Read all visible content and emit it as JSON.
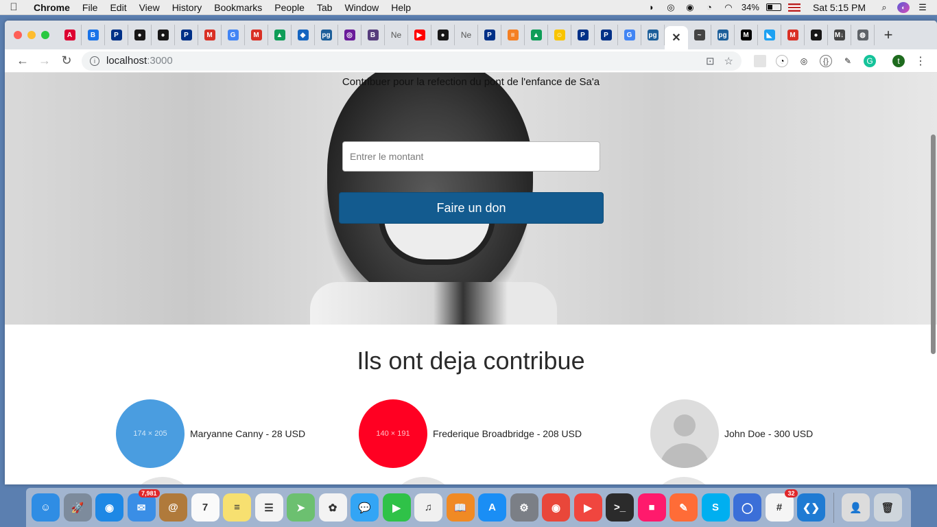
{
  "menubar": {
    "app_name": "Chrome",
    "items": [
      "File",
      "Edit",
      "View",
      "History",
      "Bookmarks",
      "People",
      "Tab",
      "Window",
      "Help"
    ],
    "battery": "34%",
    "clock": "Sat 5:15 PM"
  },
  "tabs": [
    {
      "icon": "angular-icon",
      "color": "#dd0031",
      "glyph": "A"
    },
    {
      "icon": "bootstrap-icon",
      "color": "#1a73e8",
      "glyph": "B"
    },
    {
      "icon": "paypal-icon",
      "color": "#003087",
      "glyph": "P"
    },
    {
      "icon": "github-icon",
      "color": "#181717",
      "glyph": "●"
    },
    {
      "icon": "github-icon",
      "color": "#181717",
      "glyph": "●"
    },
    {
      "icon": "paypal-icon",
      "color": "#003087",
      "glyph": "P"
    },
    {
      "icon": "gmail-icon",
      "color": "#d93025",
      "glyph": "M"
    },
    {
      "icon": "google-icon",
      "color": "#4285f4",
      "glyph": "G"
    },
    {
      "icon": "gmail-icon",
      "color": "#d93025",
      "glyph": "M"
    },
    {
      "icon": "drive-icon",
      "color": "#0f9d58",
      "glyph": "▲"
    },
    {
      "icon": "cube-icon",
      "color": "#1565c0",
      "glyph": "◆"
    },
    {
      "icon": "pg-icon",
      "color": "#1d5f9a",
      "glyph": "pg"
    },
    {
      "icon": "circle-icon",
      "color": "#6a1b9a",
      "glyph": "◎"
    },
    {
      "icon": "bootstrap-icon",
      "color": "#563d7c",
      "glyph": "B"
    },
    {
      "icon": "text-tab",
      "color": "#666666",
      "glyph": "Ne"
    },
    {
      "icon": "youtube-icon",
      "color": "#ff0000",
      "glyph": "▶"
    },
    {
      "icon": "github-icon",
      "color": "#181717",
      "glyph": "●"
    },
    {
      "icon": "text-tab",
      "color": "#666666",
      "glyph": "Ne"
    },
    {
      "icon": "paypal-icon",
      "color": "#003087",
      "glyph": "P"
    },
    {
      "icon": "stackoverflow-icon",
      "color": "#f48024",
      "glyph": "≡"
    },
    {
      "icon": "drive-icon",
      "color": "#0f9d58",
      "glyph": "▲"
    },
    {
      "icon": "emoji-icon",
      "color": "#f9c400",
      "glyph": "☺"
    },
    {
      "icon": "paypal-icon",
      "color": "#003087",
      "glyph": "P"
    },
    {
      "icon": "paypal-icon",
      "color": "#003087",
      "glyph": "P"
    },
    {
      "icon": "google-icon",
      "color": "#4285f4",
      "glyph": "G"
    },
    {
      "icon": "pg-icon",
      "color": "#1d5f9a",
      "glyph": "pg"
    }
  ],
  "tabs_after": [
    {
      "icon": "wave-icon",
      "color": "#444444",
      "glyph": "~"
    },
    {
      "icon": "pg-icon",
      "color": "#1d5f9a",
      "glyph": "pg"
    },
    {
      "icon": "medium-icon",
      "color": "#000000",
      "glyph": "M"
    },
    {
      "icon": "bird-icon",
      "color": "#1da1f2",
      "glyph": "◣"
    },
    {
      "icon": "gmail-icon",
      "color": "#d93025",
      "glyph": "M"
    },
    {
      "icon": "github-icon",
      "color": "#181717",
      "glyph": "●"
    },
    {
      "icon": "markdown-icon",
      "color": "#444444",
      "glyph": "M↓"
    },
    {
      "icon": "globe-icon",
      "color": "#5f6368",
      "glyph": "◍"
    }
  ],
  "active_tab_close": "✕",
  "new_tab": "+",
  "address": {
    "host": "localhost",
    "port": ":3000"
  },
  "hero": {
    "title": "Contribuer pour la refection du pont de l'enfance de Sa'a",
    "amount_placeholder": "Entrer le montant",
    "donate_label": "Faire un don"
  },
  "contributors": {
    "heading": "Ils ont deja contribue",
    "items": [
      {
        "label": "Maryanne Canny - 28 USD",
        "avatar_text": "174 × 205",
        "avatar_color": "#4a9de0"
      },
      {
        "label": "Frederique Broadbridge - 208 USD",
        "avatar_text": "140 × 191",
        "avatar_color": "#ff0022"
      },
      {
        "label": "John Doe - 300 USD",
        "avatar_text": "",
        "avatar_color": "#dddddd"
      }
    ]
  },
  "dock": {
    "apps": [
      {
        "name": "finder-icon",
        "color": "#2f8de4",
        "glyph": "☺"
      },
      {
        "name": "launchpad-icon",
        "color": "#7d8b9c",
        "glyph": "🚀"
      },
      {
        "name": "safari-icon",
        "color": "#1e88e5",
        "glyph": "◉"
      },
      {
        "name": "mail-icon",
        "color": "#3a8ee6",
        "glyph": "✉",
        "badge": "7,981"
      },
      {
        "name": "contacts-icon",
        "color": "#b07a3b",
        "glyph": "@"
      },
      {
        "name": "calendar-icon",
        "color": "#fafafa",
        "glyph": "7",
        "dark": true
      },
      {
        "name": "notes-icon",
        "color": "#f7e070",
        "glyph": "≡",
        "dark": true
      },
      {
        "name": "reminders-icon",
        "color": "#f4f4f4",
        "glyph": "☰",
        "dark": true
      },
      {
        "name": "maps-icon",
        "color": "#6cc070",
        "glyph": "➤"
      },
      {
        "name": "photos-icon",
        "color": "#f3f3f3",
        "glyph": "✿",
        "dark": true
      },
      {
        "name": "messages-icon",
        "color": "#33a5f5",
        "glyph": "💬"
      },
      {
        "name": "facetime-icon",
        "color": "#2fc248",
        "glyph": "▶"
      },
      {
        "name": "itunes-icon",
        "color": "#f0f0f0",
        "glyph": "♫",
        "dark": true
      },
      {
        "name": "books-icon",
        "color": "#f08a24",
        "glyph": "📖"
      },
      {
        "name": "appstore-icon",
        "color": "#1a8ef5",
        "glyph": "A"
      },
      {
        "name": "system-preferences-icon",
        "color": "#7b7f86",
        "glyph": "⚙"
      },
      {
        "name": "chrome-icon",
        "color": "#e9473a",
        "glyph": "◉"
      },
      {
        "name": "player-icon",
        "color": "#f0463f",
        "glyph": "▶"
      },
      {
        "name": "terminal-icon",
        "color": "#2b2b2b",
        "glyph": ">_"
      },
      {
        "name": "screenflow-icon",
        "color": "#ff1a6c",
        "glyph": "■"
      },
      {
        "name": "postman-icon",
        "color": "#ff6c37",
        "glyph": "✎"
      },
      {
        "name": "skype-icon",
        "color": "#00aff0",
        "glyph": "S"
      },
      {
        "name": "chromium-icon",
        "color": "#3b6fd8",
        "glyph": "◯"
      },
      {
        "name": "slack-icon",
        "color": "#f5f5f5",
        "glyph": "#",
        "badge": "32",
        "dark": true
      },
      {
        "name": "vscode-icon",
        "color": "#1f7bd3",
        "glyph": "❮❯"
      }
    ],
    "extra": [
      {
        "name": "document-icon",
        "color": "#dcdcdc",
        "glyph": "👤",
        "dark": true
      },
      {
        "name": "trash-icon",
        "color": "#cfd6dc",
        "glyph": "🗑",
        "dark": true
      }
    ]
  }
}
